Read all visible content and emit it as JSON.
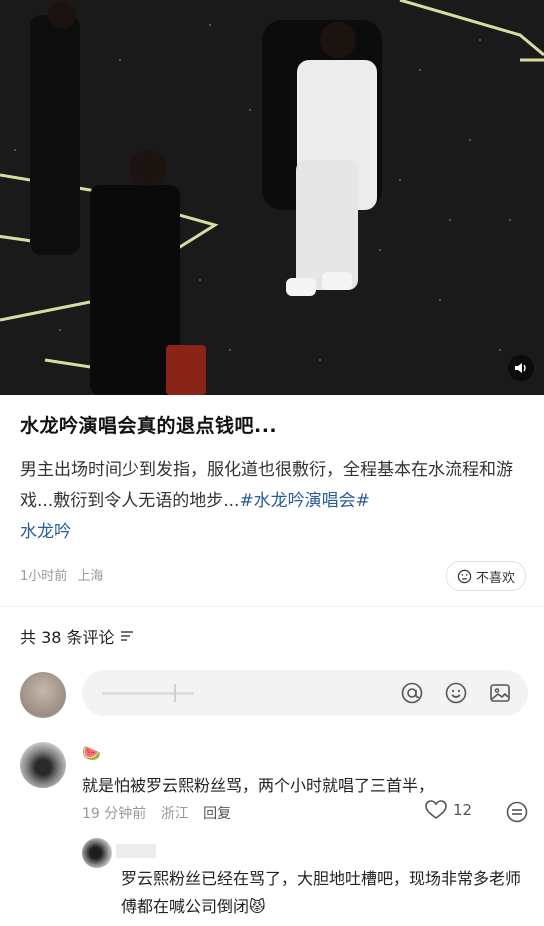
{
  "post": {
    "title": "水龙吟演唱会真的退点钱吧...",
    "body_text": "男主出场时间少到发指，服化道也很敷衍，全程基本在水流程和游戏...敷衍到令人无语的地步...",
    "tag_1": "#水龙吟演唱会#",
    "tag_2": "水龙吟",
    "time": "1小时前",
    "location": "上海",
    "dislike_label": "不喜欢",
    "photo_icons": {
      "volume": "volume-icon"
    }
  },
  "comments_header": {
    "label": "共 38 条评论",
    "sort_icon": "sort-icon"
  },
  "composer": {
    "icons": [
      "at-icon",
      "emoji-icon",
      "image-icon"
    ]
  },
  "comment": {
    "emoji": "🍉",
    "text": "就是怕被罗云熙粉丝骂，两个小时就唱了三首半，",
    "time": "19 分钟前",
    "location": "浙江",
    "reply_label": "回复",
    "like_count": "12"
  },
  "sub_reply": {
    "text": "罗云熙粉丝已经在骂了，大胆地吐槽吧，现场非常多老师傅都在喊公司倒闭😾"
  },
  "colors": {
    "tag": "#2b5b9a",
    "meta": "#9a9a9a"
  }
}
